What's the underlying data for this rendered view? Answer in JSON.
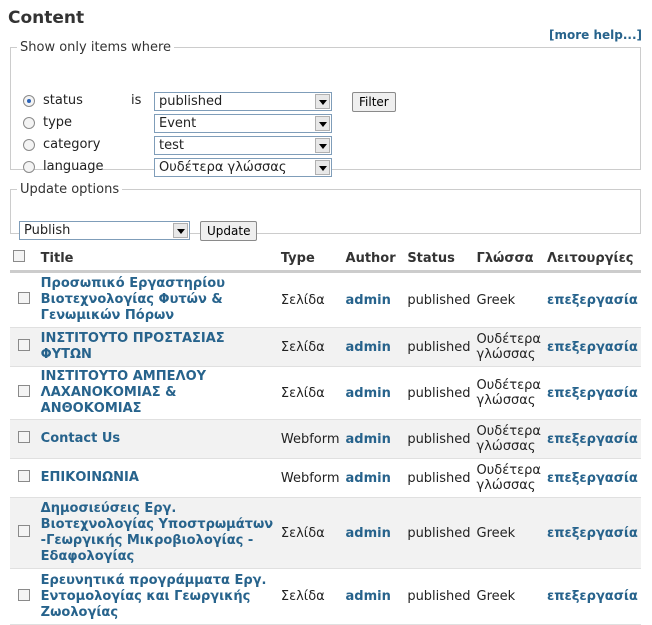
{
  "page": {
    "title": "Content",
    "more_help": "[more help...]"
  },
  "filter": {
    "legend": "Show only items where",
    "rows": [
      {
        "label": "status",
        "is": "is",
        "value": "published",
        "checked": true
      },
      {
        "label": "type",
        "value": "Event",
        "checked": false
      },
      {
        "label": "category",
        "value": "test",
        "checked": false
      },
      {
        "label": "language",
        "value": "Ουδέτερα γλώσσας",
        "checked": false
      }
    ],
    "button": "Filter"
  },
  "update": {
    "legend": "Update options",
    "selected": "Publish",
    "button": "Update"
  },
  "table": {
    "headers": {
      "title": "Title",
      "type": "Type",
      "author": "Author",
      "status": "Status",
      "language": "Γλώσσα",
      "operations": "Λειτουργίες"
    },
    "rows": [
      {
        "title": "Προσωπικό Εργαστηρίου Βιοτεχνολογίας Φυτών & Γενωμικών Πόρων",
        "type": "Σελίδα",
        "author": "admin",
        "status": "published",
        "language": "Greek",
        "op": "επεξεργασία"
      },
      {
        "title": "ΙΝΣΤΙΤΟΥΤΟ ΠΡΟΣΤΑΣΙΑΣ ΦΥΤΩΝ",
        "type": "Σελίδα",
        "author": "admin",
        "status": "published",
        "language": "Ουδέτερα γλώσσας",
        "op": "επεξεργασία"
      },
      {
        "title": "ΙΝΣΤΙΤΟΥΤΟ ΑΜΠΕΛΟΥ ΛΑΧΑΝΟΚΟΜΙΑΣ & ΑΝΘΟΚΟΜΙΑΣ",
        "type": "Σελίδα",
        "author": "admin",
        "status": "published",
        "language": "Ουδέτερα γλώσσας",
        "op": "επεξεργασία"
      },
      {
        "title": "Contact Us",
        "type": "Webform",
        "author": "admin",
        "status": "published",
        "language": "Ουδέτερα γλώσσας",
        "op": "επεξεργασία"
      },
      {
        "title": "ΕΠΙΚΟΙΝΩΝΙΑ",
        "type": "Webform",
        "author": "admin",
        "status": "published",
        "language": "Ουδέτερα γλώσσας",
        "op": "επεξεργασία"
      },
      {
        "title": "Δημοσιεύσεις Εργ. Βιοτεχνολογίας Υποστρωμάτων -Γεωργικής Μικροβιολογίας - Εδαφολογίας",
        "type": "Σελίδα",
        "author": "admin",
        "status": "published",
        "language": "Greek",
        "op": "επεξεργασία"
      },
      {
        "title": "Ερευνητικά προγράμματα Εργ. Εντομολογίας και Γεωργικής Ζωολογίας",
        "type": "Σελίδα",
        "author": "admin",
        "status": "published",
        "language": "Greek",
        "op": "επεξεργασία"
      }
    ]
  }
}
